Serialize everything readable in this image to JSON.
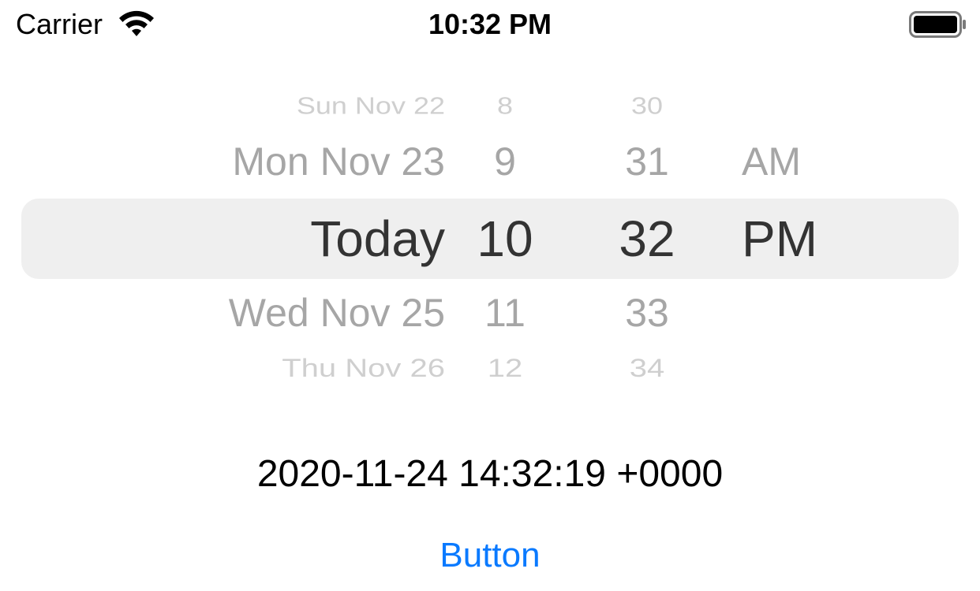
{
  "status_bar": {
    "carrier": "Carrier",
    "time": "10:32 PM",
    "wifi_icon": "wifi-icon",
    "battery_icon": "battery-icon"
  },
  "picker": {
    "dates": {
      "far_above": "Sun Nov 22",
      "above": "Mon Nov 23",
      "selected": "Today",
      "below": "Wed Nov 25",
      "far_below": "Thu Nov 26"
    },
    "hours": {
      "far_above": "8",
      "above": "9",
      "selected": "10",
      "below": "11",
      "far_below": "12"
    },
    "minutes": {
      "far_above": "30",
      "above": "31",
      "selected": "32",
      "below": "33",
      "far_below": "34"
    },
    "ampm": {
      "above": "AM",
      "selected": "PM"
    }
  },
  "date_label": "2020-11-24 14:32:19 +0000",
  "button_label": "Button",
  "colors": {
    "accent": "#0a7aff",
    "highlight": "#efefef",
    "selected_text": "#333333",
    "unselected_text": "#a6a6a6"
  }
}
